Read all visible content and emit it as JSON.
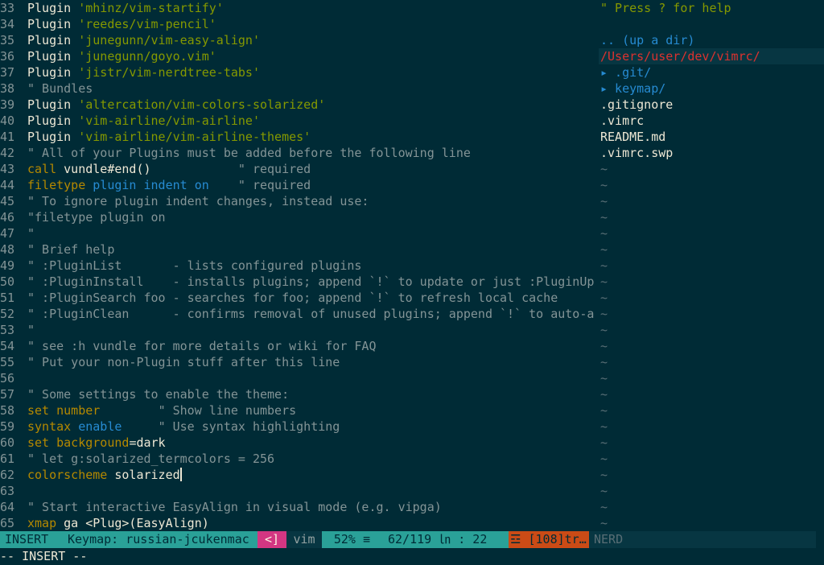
{
  "editor": {
    "lines": [
      {
        "n": "33",
        "parts": [
          {
            "t": "Plugin ",
            "c": "plain"
          },
          {
            "t": "'mhinz/vim-startify'",
            "c": "str"
          }
        ]
      },
      {
        "n": "34",
        "parts": [
          {
            "t": "Plugin ",
            "c": "plain"
          },
          {
            "t": "'reedes/vim-pencil'",
            "c": "str"
          }
        ]
      },
      {
        "n": "35",
        "parts": [
          {
            "t": "Plugin ",
            "c": "plain"
          },
          {
            "t": "'junegunn/vim-easy-align'",
            "c": "str"
          }
        ]
      },
      {
        "n": "36",
        "parts": [
          {
            "t": "Plugin ",
            "c": "plain"
          },
          {
            "t": "'junegunn/goyo.vim'",
            "c": "str"
          }
        ]
      },
      {
        "n": "37",
        "parts": [
          {
            "t": "Plugin ",
            "c": "plain"
          },
          {
            "t": "'jistr/vim-nerdtree-tabs'",
            "c": "str"
          }
        ]
      },
      {
        "n": "38",
        "parts": [
          {
            "t": "\" Bundles",
            "c": "cmt"
          }
        ]
      },
      {
        "n": "39",
        "parts": [
          {
            "t": "Plugin ",
            "c": "plain"
          },
          {
            "t": "'altercation/vim-colors-solarized'",
            "c": "str"
          }
        ]
      },
      {
        "n": "40",
        "parts": [
          {
            "t": "Plugin ",
            "c": "plain"
          },
          {
            "t": "'vim-airline/vim-airline'",
            "c": "str"
          }
        ]
      },
      {
        "n": "41",
        "parts": [
          {
            "t": "Plugin ",
            "c": "plain"
          },
          {
            "t": "'vim-airline/vim-airline-themes'",
            "c": "str"
          }
        ]
      },
      {
        "n": "42",
        "parts": [
          {
            "t": "\" All of your Plugins must be added before the following line",
            "c": "cmt"
          }
        ]
      },
      {
        "n": "43",
        "parts": [
          {
            "t": "call",
            "c": "kw"
          },
          {
            "t": " vundle#end()            ",
            "c": "plain"
          },
          {
            "t": "\" required",
            "c": "cmt"
          }
        ]
      },
      {
        "n": "44",
        "parts": [
          {
            "t": "filetype",
            "c": "kw"
          },
          {
            "t": " ",
            "c": "plain"
          },
          {
            "t": "plugin",
            "c": "opt"
          },
          {
            "t": " ",
            "c": "plain"
          },
          {
            "t": "indent",
            "c": "opt"
          },
          {
            "t": " ",
            "c": "plain"
          },
          {
            "t": "on",
            "c": "opt"
          },
          {
            "t": "    ",
            "c": "plain"
          },
          {
            "t": "\" required",
            "c": "cmt"
          }
        ]
      },
      {
        "n": "45",
        "parts": [
          {
            "t": "\" To ignore plugin indent changes, instead use:",
            "c": "cmt"
          }
        ]
      },
      {
        "n": "46",
        "parts": [
          {
            "t": "\"filetype plugin on",
            "c": "cmt"
          }
        ]
      },
      {
        "n": "47",
        "parts": [
          {
            "t": "\"",
            "c": "cmt"
          }
        ]
      },
      {
        "n": "48",
        "parts": [
          {
            "t": "\" Brief help",
            "c": "cmt"
          }
        ]
      },
      {
        "n": "49",
        "parts": [
          {
            "t": "\" :PluginList       - lists configured plugins",
            "c": "cmt"
          }
        ]
      },
      {
        "n": "50",
        "parts": [
          {
            "t": "\" :PluginInstall    - installs plugins; append `!` to update or just :PluginUp",
            "c": "cmt"
          }
        ]
      },
      {
        "n": "51",
        "parts": [
          {
            "t": "\" :PluginSearch foo - searches for foo; append `!` to refresh local cache",
            "c": "cmt"
          }
        ]
      },
      {
        "n": "52",
        "parts": [
          {
            "t": "\" :PluginClean      - confirms removal of unused plugins; append `!` to auto-a",
            "c": "cmt"
          }
        ]
      },
      {
        "n": "53",
        "parts": [
          {
            "t": "\"",
            "c": "cmt"
          }
        ]
      },
      {
        "n": "54",
        "parts": [
          {
            "t": "\" see :h vundle for more details or wiki for FAQ",
            "c": "cmt"
          }
        ]
      },
      {
        "n": "55",
        "parts": [
          {
            "t": "\" Put your non-Plugin stuff after this line",
            "c": "cmt"
          }
        ]
      },
      {
        "n": "56",
        "parts": []
      },
      {
        "n": "57",
        "parts": [
          {
            "t": "\" Some settings to enable the theme:",
            "c": "cmt"
          }
        ]
      },
      {
        "n": "58",
        "parts": [
          {
            "t": "set",
            "c": "kw"
          },
          {
            "t": " ",
            "c": "plain"
          },
          {
            "t": "number",
            "c": "kw"
          },
          {
            "t": "        ",
            "c": "plain"
          },
          {
            "t": "\" Show line numbers",
            "c": "cmt"
          }
        ]
      },
      {
        "n": "59",
        "parts": [
          {
            "t": "syntax",
            "c": "kw"
          },
          {
            "t": " ",
            "c": "plain"
          },
          {
            "t": "enable",
            "c": "opt"
          },
          {
            "t": "     ",
            "c": "plain"
          },
          {
            "t": "\" Use syntax highlighting",
            "c": "cmt"
          }
        ]
      },
      {
        "n": "60",
        "parts": [
          {
            "t": "set",
            "c": "kw"
          },
          {
            "t": " ",
            "c": "plain"
          },
          {
            "t": "background",
            "c": "kw"
          },
          {
            "t": "=dark",
            "c": "plain"
          }
        ]
      },
      {
        "n": "61",
        "parts": [
          {
            "t": "\" let g:solarized_termcolors = 256",
            "c": "cmt"
          }
        ]
      },
      {
        "n": "62",
        "parts": [
          {
            "t": "colorscheme",
            "c": "kw"
          },
          {
            "t": " solarized",
            "c": "plain"
          }
        ],
        "cursor": true
      },
      {
        "n": "63",
        "parts": []
      },
      {
        "n": "64",
        "parts": [
          {
            "t": "\" Start interactive EasyAlign in visual mode (e.g. vipga)",
            "c": "cmt"
          }
        ]
      },
      {
        "n": "65",
        "parts": [
          {
            "t": "xmap",
            "c": "kw"
          },
          {
            "t": " ga <Plug>(EasyAlign)",
            "c": "plain"
          }
        ]
      }
    ]
  },
  "tree": {
    "help": "\" Press ? for help",
    "updir": ".. (up a dir)",
    "root": "/Users/user/dev/vimrc/",
    "dirs": [
      "▸ .git/",
      "▸ keymap/"
    ],
    "files": [
      ".gitignore",
      ".vimrc",
      "README.md",
      ".vimrc.swp"
    ],
    "tilde": "~",
    "tilde_count": 23
  },
  "statusbar": {
    "mode": "INSERT",
    "keymap": "Keymap: russian-jcukenmac",
    "arrow": "<]",
    "filetype": "vim",
    "percent": "52% ≡",
    "position": "62/119 ㏑ : 22",
    "warning": "☲ [108]tr…",
    "nerd": "NERD"
  },
  "cmdline": "-- INSERT --",
  "colors": {
    "background": "#002b36",
    "accent": "#2aa198",
    "magenta": "#d33682",
    "orange": "#cb4b16"
  }
}
